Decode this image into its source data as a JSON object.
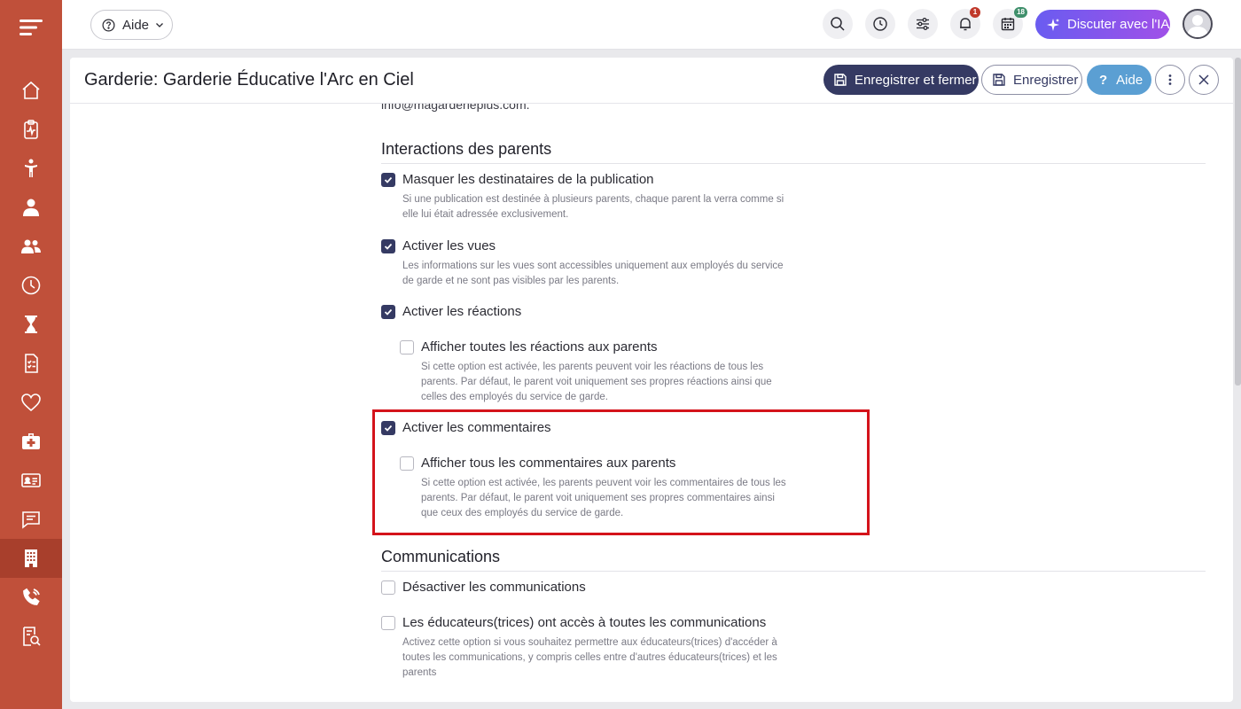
{
  "sidebar": {
    "items": [
      {
        "name": "home",
        "icon": "home-icon"
      },
      {
        "name": "health",
        "icon": "clipboard-pulse-icon"
      },
      {
        "name": "child",
        "icon": "child-icon"
      },
      {
        "name": "staff",
        "icon": "person-icon"
      },
      {
        "name": "groups",
        "icon": "people-icon"
      },
      {
        "name": "time",
        "icon": "clock-icon"
      },
      {
        "name": "timer",
        "icon": "hourglass-icon"
      },
      {
        "name": "reports",
        "icon": "checklist-icon"
      },
      {
        "name": "wellbeing",
        "icon": "heart-icon"
      },
      {
        "name": "medical",
        "icon": "medical-kit-icon"
      },
      {
        "name": "id-card",
        "icon": "id-card-icon"
      },
      {
        "name": "messages",
        "icon": "chat-icon"
      },
      {
        "name": "daycare",
        "icon": "building-icon",
        "active": true
      },
      {
        "name": "calls",
        "icon": "phone-icon"
      },
      {
        "name": "analytics",
        "icon": "report-search-icon"
      }
    ]
  },
  "topbar": {
    "help_label": "Aide",
    "ai_button_label": "Discuter avec l'IA",
    "notifications_count": "1",
    "calendar_count": "18"
  },
  "header": {
    "title": "Garderie: Garderie Éducative l'Arc en Ciel",
    "save_close_label": "Enregistrer et fermer",
    "save_label": "Enregistrer",
    "help_label": "Aide"
  },
  "content": {
    "cut_email": "info@magarderieplus.com.",
    "section_parents": "Interactions des parents",
    "opt_hide_recipients": {
      "label": "Masquer les destinataires de la publication",
      "checked": true,
      "desc_1": "Si une publication est destinée à plusieurs parents, chaque parent la verra comme si",
      "desc_2": "elle lui était adressée exclusivement."
    },
    "opt_views": {
      "label": "Activer les vues",
      "checked": true,
      "desc_1": "Les informations sur les vues sont accessibles uniquement aux employés du service",
      "desc_2": "de garde et ne sont pas visibles par les parents."
    },
    "opt_reactions": {
      "label": "Activer les réactions",
      "checked": true
    },
    "opt_show_reactions": {
      "label": "Afficher toutes les réactions aux parents",
      "checked": false,
      "desc_1": "Si cette option est activée, les parents peuvent voir les réactions de tous les",
      "desc_2": "parents. Par défaut, le parent voit uniquement ses propres réactions ainsi que",
      "desc_3": "celles des employés du service de garde."
    },
    "opt_comments": {
      "label": "Activer les commentaires",
      "checked": true
    },
    "opt_show_comments": {
      "label": "Afficher tous les commentaires aux parents",
      "checked": false,
      "desc_1": "Si cette option est activée, les parents peuvent voir les commentaires de tous les",
      "desc_2": "parents. Par défaut, le parent voit uniquement ses propres commentaires ainsi",
      "desc_3": "que ceux des employés du service de garde."
    },
    "section_comms": "Communications",
    "opt_disable_comms": {
      "label": "Désactiver les communications",
      "checked": false
    },
    "opt_educators_access": {
      "label": "Les éducateurs(trices) ont accès à toutes les communications",
      "checked": false,
      "desc_1": "Activez cette option si vous souhaitez permettre aux éducateurs(trices) d'accéder à",
      "desc_2": "toutes les communications, y compris celles entre d'autres éducateurs(trices) et les",
      "desc_3": "parents"
    }
  },
  "colors": {
    "sidebar": "#c0503a",
    "primary": "#353a63",
    "help": "#5b9fd3",
    "highlight": "#d4131b"
  }
}
